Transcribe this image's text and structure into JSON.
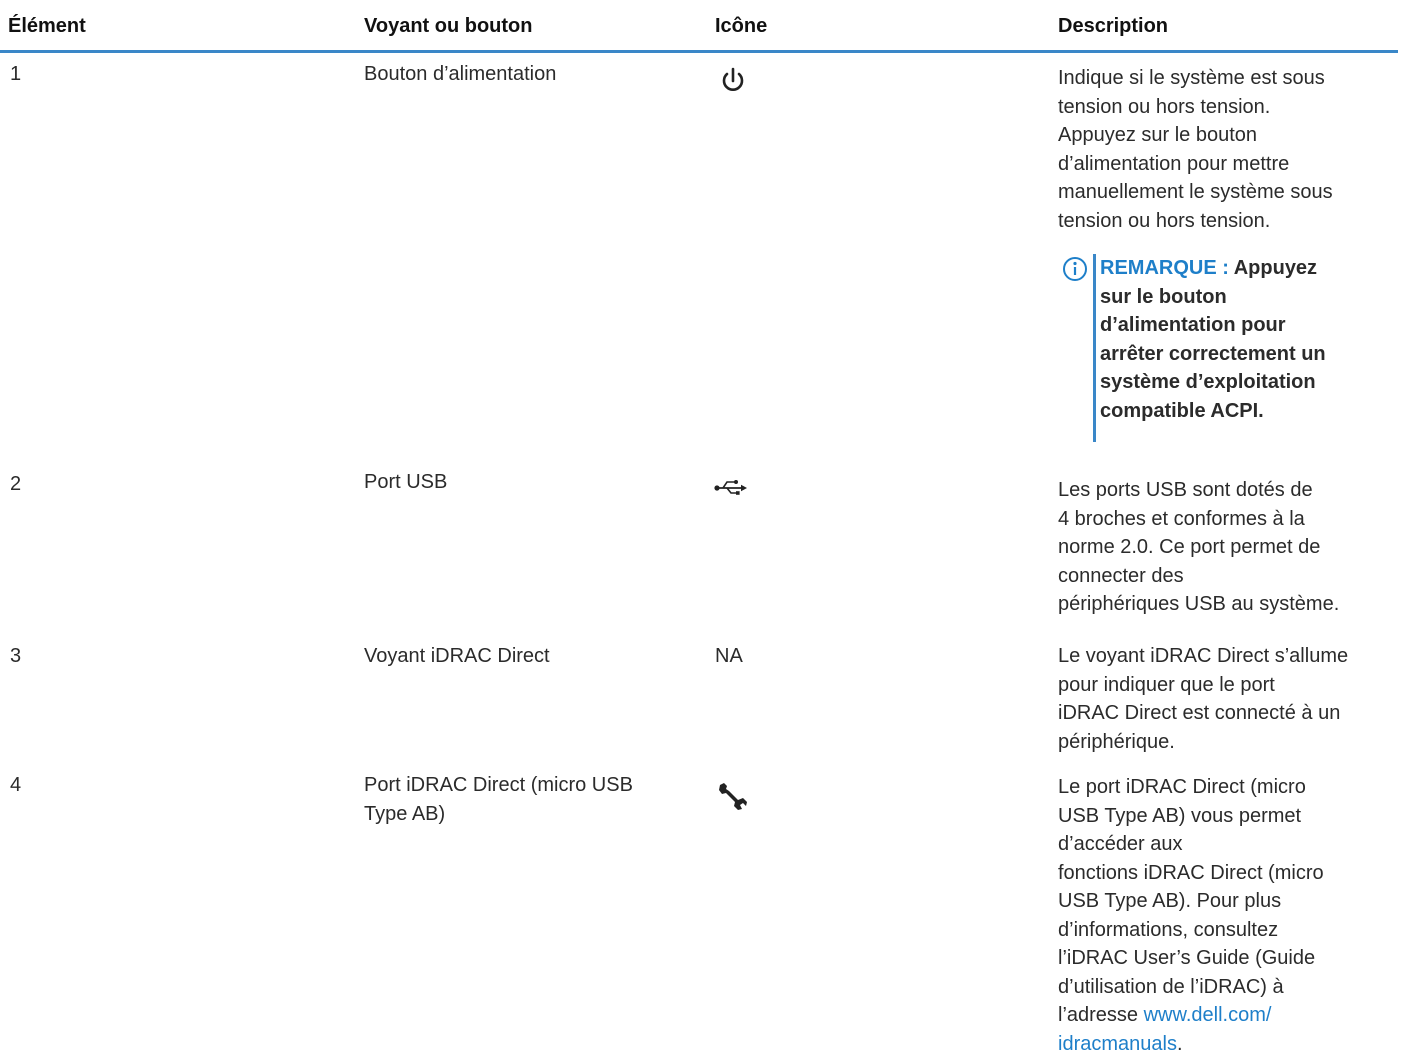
{
  "table": {
    "headers": {
      "item": "Élément",
      "control": "Voyant ou bouton",
      "icon": "Icône",
      "description": "Description"
    },
    "rows": [
      {
        "item": "1",
        "control": "Bouton d’alimentation",
        "icon": "power-icon",
        "description_lines": [
          "Indique si le système est sous",
          "tension ou hors tension.",
          "Appuyez sur le bouton",
          "d’alimentation pour mettre",
          "manuellement le système sous",
          "tension ou hors tension."
        ],
        "note": {
          "label": "REMARQUE :",
          "text_lines": [
            "Appuyez",
            "sur le bouton",
            "d’alimentation pour",
            "arrêter correctement un",
            "système d’exploitation",
            "compatible ACPI."
          ]
        }
      },
      {
        "item": "2",
        "control": "Port USB",
        "icon": "usb-icon",
        "description_lines": [
          "Les ports USB sont dotés de",
          "4 broches et conformes à la",
          "norme 2.0. Ce port permet de",
          "connecter des",
          "périphériques USB au système."
        ]
      },
      {
        "item": "3",
        "control": "Voyant iDRAC Direct",
        "icon_text": "NA",
        "description_lines": [
          "Le voyant iDRAC Direct s’allume",
          "pour indiquer que le port",
          "iDRAC Direct est connecté à un",
          "périphérique."
        ]
      },
      {
        "item": "4",
        "control_lines": [
          "Port iDRAC Direct (micro USB",
          "Type AB)"
        ],
        "icon": "wrench-icon",
        "description_lines": [
          "Le port iDRAC Direct (micro",
          "USB Type AB) vous permet",
          "d’accéder aux",
          "fonctions iDRAC Direct (micro",
          "USB Type AB). Pour plus",
          "d’informations, consultez",
          "l’iDRAC User’s Guide (Guide",
          "d’utilisation de l’iDRAC) à",
          "l’adresse"
        ],
        "link_line1": "www.dell.com/",
        "link_line2": "idracmanuals",
        "trailing": "."
      }
    ]
  },
  "colors": {
    "accent": "#3a87c8",
    "link": "#1e7fc9",
    "text": "#2b2b2b"
  }
}
